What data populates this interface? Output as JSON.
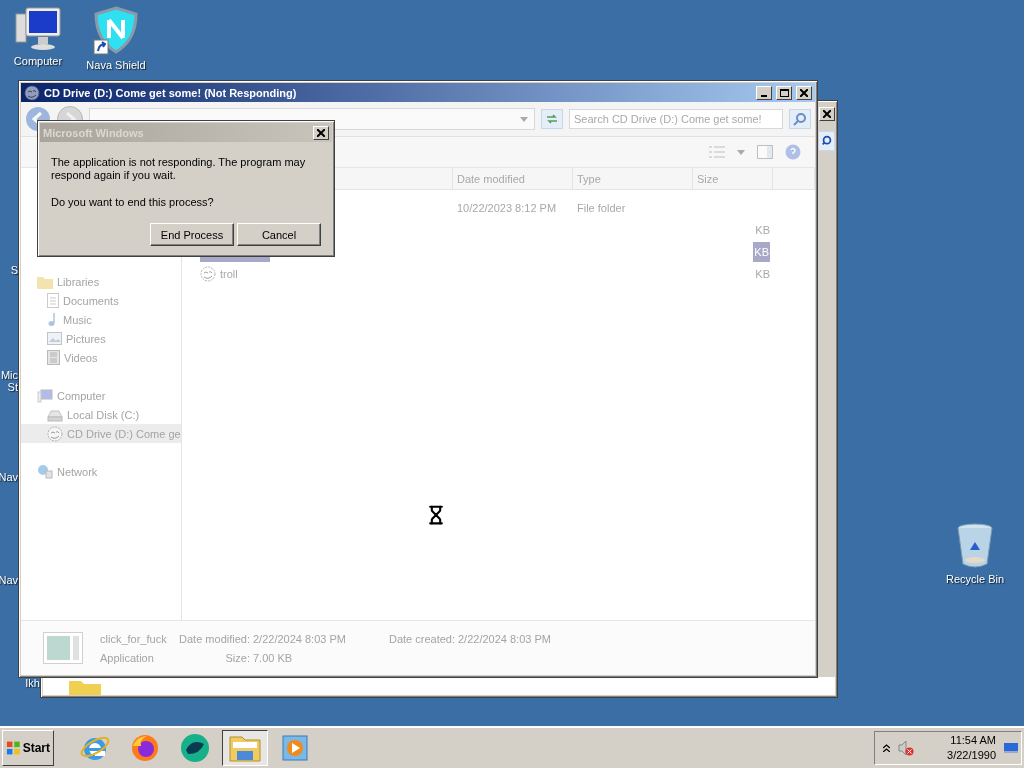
{
  "desktop": {
    "icons": [
      {
        "kind": "computer",
        "label": "Computer"
      },
      {
        "kind": "shield",
        "label": "Nava Shield"
      },
      {
        "kind": "recycle",
        "label": "Recycle Bin"
      }
    ],
    "hidden_icon_labels": [
      "S",
      "Mic St",
      "Nav",
      "Nav",
      "Ikh"
    ]
  },
  "explorer": {
    "title": "CD Drive (D:) Come get some! (Not Responding)",
    "search": {
      "placeholder": "Search CD Drive (D:) Come get some!"
    },
    "nav": [
      {
        "kind": "libraries",
        "label": "Libraries",
        "selected": false,
        "children": [
          {
            "kind": "documents",
            "label": "Documents",
            "selected": false
          },
          {
            "kind": "music",
            "label": "Music",
            "selected": false
          },
          {
            "kind": "pictures",
            "label": "Pictures",
            "selected": false
          },
          {
            "kind": "videos",
            "label": "Videos",
            "selected": false
          }
        ]
      },
      {
        "kind": "computer",
        "label": "Computer",
        "selected": false,
        "children": [
          {
            "kind": "disk",
            "label": "Local Disk (C:)",
            "selected": false
          },
          {
            "kind": "cd",
            "label": "CD Drive (D:) Come ge",
            "selected": true
          }
        ]
      },
      {
        "kind": "network",
        "label": "Network",
        "selected": false
      }
    ],
    "columns": [
      "Date modified",
      "Type",
      "Size"
    ],
    "rows": [
      {
        "date": "10/22/2023 8:12 PM",
        "type": "File folder",
        "selected": false
      },
      {
        "size": "KB",
        "selected": false
      },
      {
        "size": "KB",
        "selected": true
      },
      {
        "name": "troll",
        "size": "KB",
        "selected": false
      }
    ],
    "details": {
      "name": "click_for_fuck",
      "type": "Application",
      "fields": [
        {
          "label": "Date modified:",
          "value": "2/22/2024 8:03 PM"
        },
        {
          "label": "Size:",
          "value": "7.00 KB"
        },
        {
          "label": "Date created:",
          "value": "2/22/2024 8:03 PM"
        }
      ]
    }
  },
  "dialog": {
    "title": "Microsoft Windows",
    "message": "The application is not responding. The program may respond again if you wait.",
    "question": "Do you want to end this process?",
    "buttons": [
      "End Process",
      "Cancel"
    ]
  },
  "taskbar": {
    "start": "Start",
    "apps": [
      {
        "kind": "ie",
        "selected": false
      },
      {
        "kind": "firefox",
        "selected": false
      },
      {
        "kind": "chat",
        "selected": false
      },
      {
        "kind": "explorer",
        "selected": true
      },
      {
        "kind": "media",
        "selected": false
      }
    ],
    "tray": {
      "time": "11:54 AM",
      "date": "3/22/1990"
    }
  }
}
